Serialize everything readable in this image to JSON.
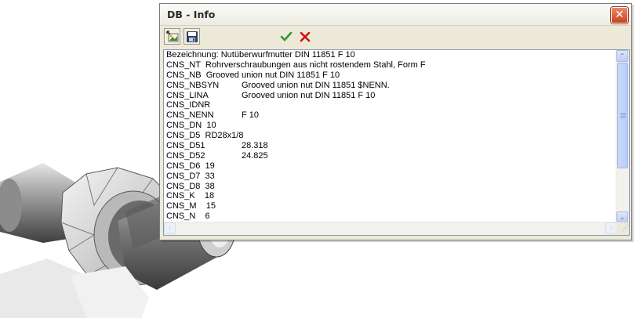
{
  "window": {
    "title": "DB - Info",
    "close_glyph": "✕"
  },
  "toolbar": {
    "buttons": [
      {
        "icon": "open-picture-icon"
      },
      {
        "icon": "save-disk-icon"
      },
      {
        "icon": "check-icon"
      },
      {
        "icon": "cancel-x-icon"
      }
    ]
  },
  "info": {
    "lines": [
      {
        "key": "Bezeichnung: Nutüberwurfmutter DIN 11851 F 10",
        "value": ""
      },
      {
        "key": "CNS_NT  Rohrverschraubungen aus nicht rostendem Stahl, Form F",
        "value": ""
      },
      {
        "key": "CNS_NB  Grooved union nut DIN 11851 F 10",
        "value": ""
      },
      {
        "key": "CNS_NBSYN",
        "value": "Grooved union nut DIN 11851 $NENN."
      },
      {
        "key": "CNS_LINA",
        "value": "Grooved union nut DIN 11851 F 10"
      },
      {
        "key": "CNS_IDNR",
        "value": ""
      },
      {
        "key": "CNS_NENN",
        "value": "F 10"
      },
      {
        "key": "CNS_DN  10",
        "value": ""
      },
      {
        "key": "CNS_D5  RD28x1/8",
        "value": ""
      },
      {
        "key": "CNS_D51",
        "value": "28.318"
      },
      {
        "key": "CNS_D52",
        "value": "24.825"
      },
      {
        "key": "CNS_D6  19",
        "value": ""
      },
      {
        "key": "CNS_D7  33",
        "value": ""
      },
      {
        "key": "CNS_D8  38",
        "value": ""
      },
      {
        "key": "CNS_K    18",
        "value": ""
      },
      {
        "key": "CNS_M    15",
        "value": ""
      },
      {
        "key": "CNS_N    6",
        "value": ""
      }
    ]
  },
  "scrollbars": {
    "up_glyph": "⌃",
    "down_glyph": "⌄",
    "left_glyph": "‹",
    "right_glyph": "›",
    "grip_glyph": "⋰"
  },
  "colors": {
    "dialog_bg": "#ece9d8",
    "close_red": "#c8431e",
    "check_green": "#2f9a2f",
    "cancel_red": "#d01010"
  }
}
